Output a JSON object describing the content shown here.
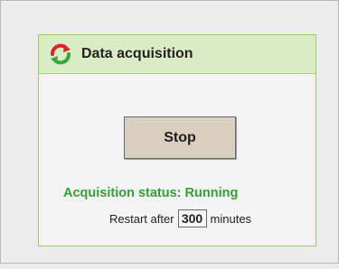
{
  "panel": {
    "title": "Data acquisition",
    "icon": "refresh-icon",
    "accent_color": "#d9ecc3"
  },
  "controls": {
    "stop_label": "Stop"
  },
  "status": {
    "text": "Acquisition status: Running",
    "color": "#35a03a"
  },
  "restart": {
    "prefix": "Restart after",
    "value": "300",
    "suffix": "minutes"
  }
}
